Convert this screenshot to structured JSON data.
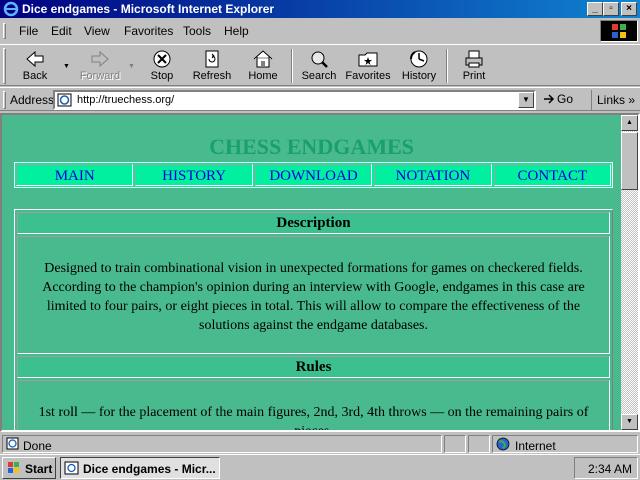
{
  "window": {
    "title": "Dice endgames - Microsoft Internet Explorer"
  },
  "menu": [
    "File",
    "Edit",
    "View",
    "Favorites",
    "Tools",
    "Help"
  ],
  "toolbar": {
    "back": "Back",
    "forward": "Forward",
    "stop": "Stop",
    "refresh": "Refresh",
    "home": "Home",
    "search": "Search",
    "favorites": "Favorites",
    "history": "History",
    "print": "Print"
  },
  "address": {
    "label": "Address",
    "url": "http://truechess.org/",
    "go": "Go",
    "links": "Links"
  },
  "page": {
    "title": "CHESS ENDGAMES",
    "nav": [
      "MAIN",
      "HISTORY",
      "DOWNLOAD",
      "NOTATION",
      "CONTACT"
    ],
    "sections": {
      "description_heading": "Description",
      "description_text": "Designed to train combinational vision in unexpected formations for games on checkered fields. According to the champion's opinion during an interview with Google, endgames in this case are limited to four pairs, or eight pieces in total. This will allow to compare the effectiveness of the solutions against the endgame databases.",
      "rules_heading": "Rules",
      "rules_text": "1st roll — for the placement of the main figures, 2nd, 3rd, 4th throws — on the remaining pairs of pieces."
    }
  },
  "status": {
    "text": "Done",
    "zone": "Internet"
  },
  "taskbar": {
    "start": "Start",
    "task": "Dice endgames - Micr...",
    "clock": "2:34 AM"
  }
}
